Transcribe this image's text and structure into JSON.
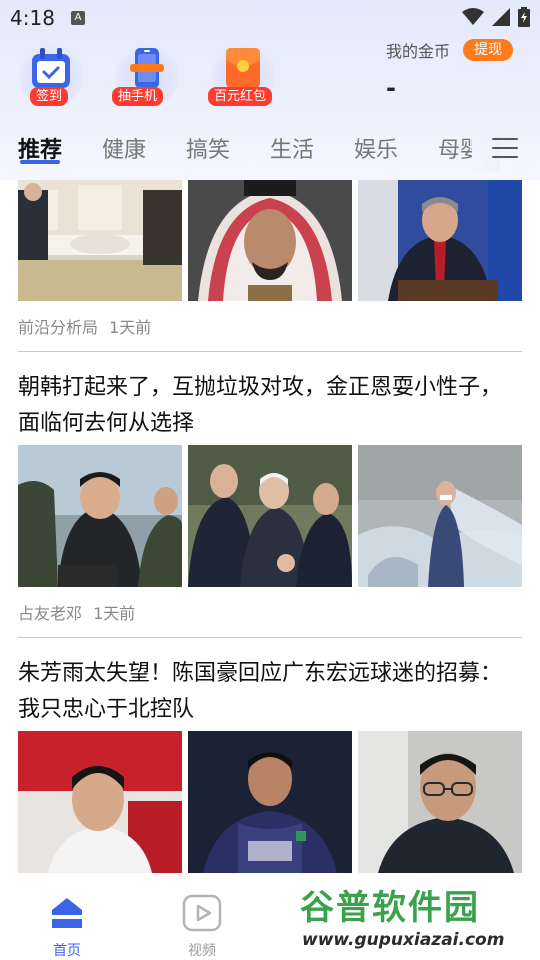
{
  "status_bar": {
    "time": "4:18",
    "notif": "A"
  },
  "quick_actions": [
    {
      "label": "签到",
      "icon": "calendar-check-icon"
    },
    {
      "label": "抽手机",
      "icon": "phone-gift-icon"
    },
    {
      "label": "百元红包",
      "icon": "red-envelope-icon"
    }
  ],
  "coins": {
    "label": "我的金币",
    "value": "-",
    "withdraw_label": "提现"
  },
  "tabs": [
    "推荐",
    "健康",
    "搞笑",
    "生活",
    "娱乐",
    "母婴"
  ],
  "feed": [
    {
      "title": "",
      "source": "前沿分析局",
      "time": "1天前",
      "images": [
        "meeting-room-photo",
        "man-in-red-headscarf-photo",
        "man-at-podium-photo"
      ]
    },
    {
      "title": "朝韩打起来了，互抛垃圾对攻，金正恩耍小性子，面临何去何从选择",
      "source": "占友老邓",
      "time": "1天前",
      "images": [
        "leader-with-officers-photo",
        "leaders-handshake-photo",
        "balloon-trash-photo"
      ]
    },
    {
      "title": "朱芳雨太失望！陈国豪回应广东宏远球迷的招募：我只忠心于北控队",
      "source": "",
      "time": "",
      "images": [
        "player-portrait-photo",
        "player-in-jersey-photo",
        "man-with-glasses-photo"
      ]
    }
  ],
  "bottom_nav": [
    {
      "label": "首页",
      "icon": "home-icon",
      "active": true
    },
    {
      "label": "视频",
      "icon": "video-icon",
      "active": false
    }
  ],
  "watermark": {
    "logo": "谷普软件园",
    "url": "www.gupuxiazai.com"
  },
  "colors": {
    "accent": "#3b64e8",
    "red_tag": "#ff3b2f",
    "withdraw": "#ff7a1a"
  }
}
